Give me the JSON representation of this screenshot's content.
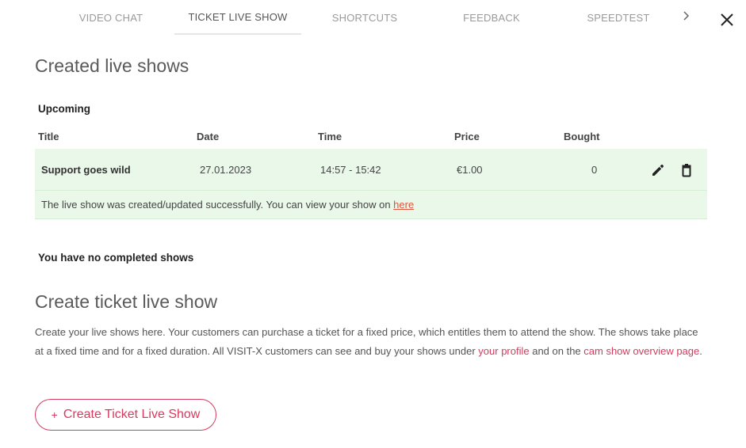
{
  "tabs": [
    {
      "label": "VIDEO CHAT"
    },
    {
      "label": "TICKET LIVE SHOW"
    },
    {
      "label": "SHORTCUTS"
    },
    {
      "label": "FEEDBACK"
    },
    {
      "label": "SPEEDTEST"
    }
  ],
  "created": {
    "heading": "Created live shows",
    "upcoming_label": "Upcoming",
    "columns": {
      "title": "Title",
      "date": "Date",
      "time": "Time",
      "price": "Price",
      "bought": "Bought"
    },
    "rows": [
      {
        "title": "Support goes wild",
        "date": "27.01.2023",
        "time": "14:57 - 15:42",
        "price": "€1.00",
        "bought": "0"
      }
    ],
    "success_message": "The live show was created/updated successfully. You can view your show on ",
    "success_link": "here",
    "completed_empty": "You have no completed shows"
  },
  "create": {
    "heading": "Create ticket live show",
    "desc_part1": "Create your live shows here. Your customers can purchase a ticket for a fixed price, which entitles them to attend the show. The shows take place at a fixed time and for a fixed duration. All VISIT-X customers can see and buy your shows under ",
    "link_profile": "your profile",
    "desc_part2": " and on the ",
    "link_overview": "cam show overview page",
    "desc_part3": ".",
    "button_plus": "+",
    "button_label": "Create Ticket Live Show"
  },
  "colors": {
    "accent": "#d63a5e",
    "success_bg": "#e9f8e9",
    "link_here": "#e0553f"
  },
  "icons": {
    "next": "chevron-right-icon",
    "close": "close-icon",
    "edit": "pencil-icon",
    "delete": "trash-icon"
  }
}
